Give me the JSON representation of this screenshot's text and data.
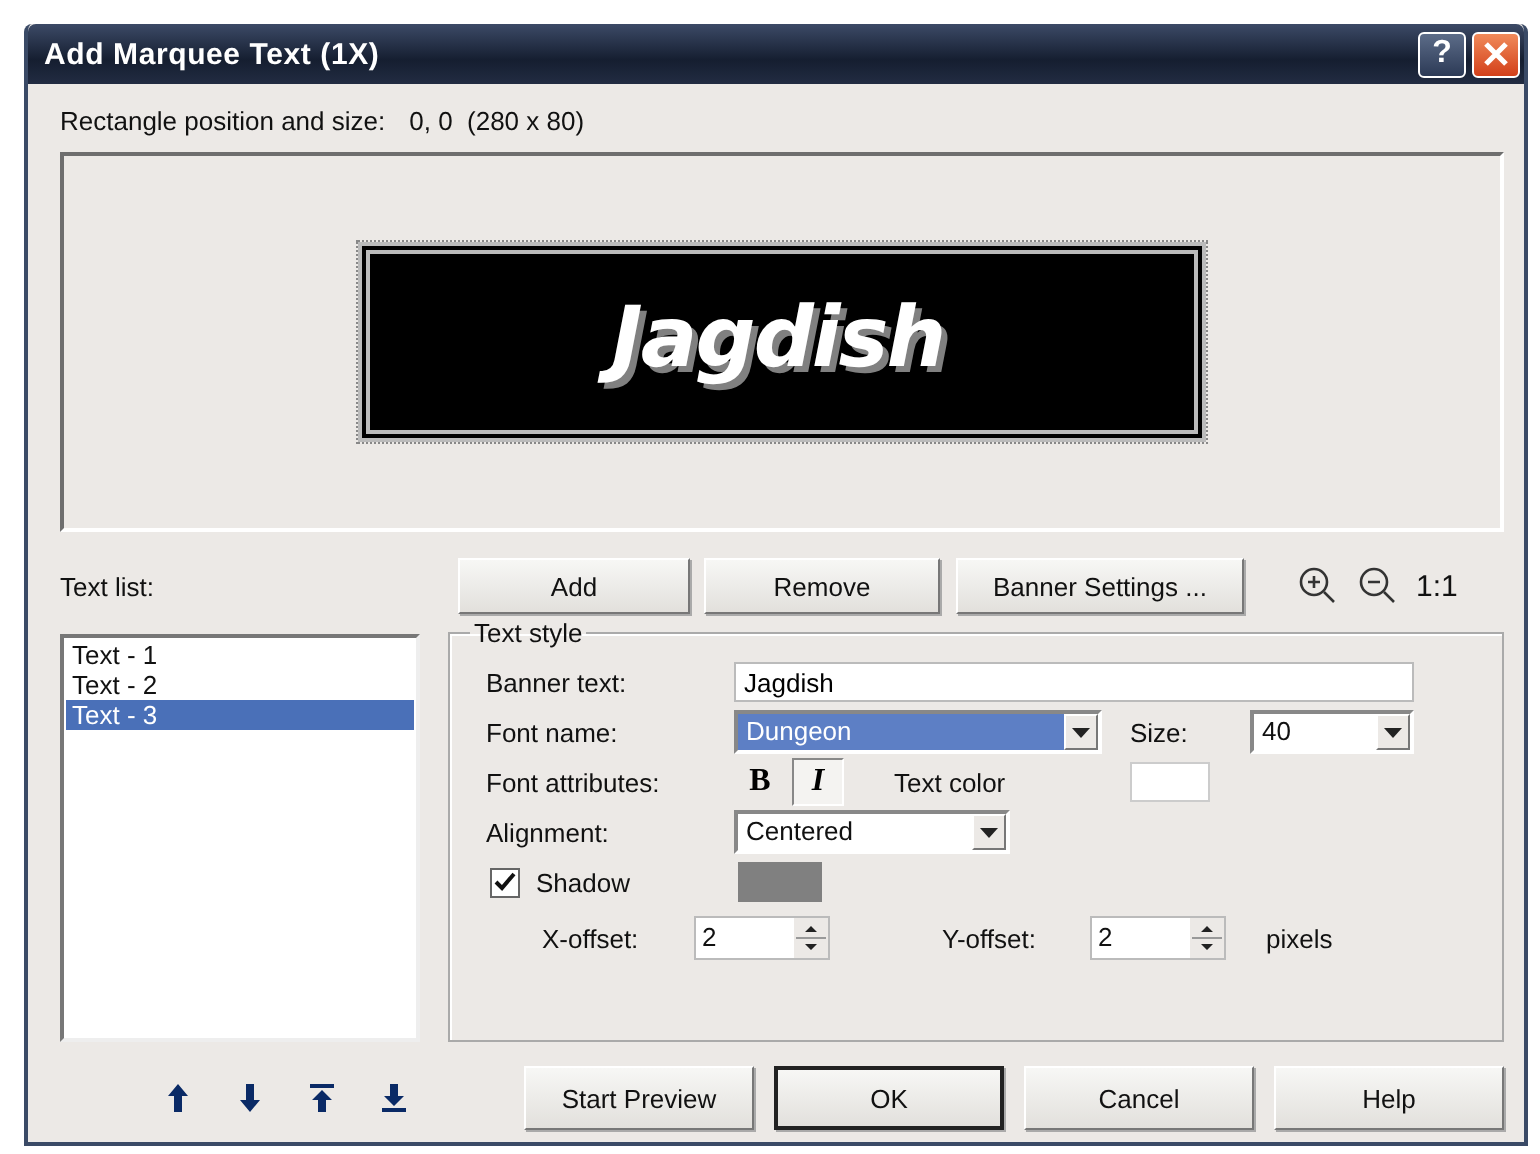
{
  "window": {
    "title": "Add Marquee Text (1X)",
    "help_glyph": "?"
  },
  "position": {
    "label": "Rectangle position and size:",
    "value": "0, 0  (280 x 80)"
  },
  "preview": {
    "text": "Jagdish"
  },
  "text_list": {
    "label": "Text list:",
    "items": [
      {
        "label": "Text - 1",
        "selected": false
      },
      {
        "label": "Text - 2",
        "selected": false
      },
      {
        "label": "Text - 3",
        "selected": true
      }
    ]
  },
  "toolbar": {
    "buttons": [
      "Add",
      "Remove",
      "Banner Settings ..."
    ],
    "zoom_label": "1:1"
  },
  "text_style": {
    "title": "Text style",
    "banner_text": {
      "label": "Banner text:",
      "value": "Jagdish"
    },
    "font_name": {
      "label": "Font name:",
      "value": "Dungeon",
      "highlighted": true
    },
    "size": {
      "label": "Size:",
      "value": "40"
    },
    "font_attributes": {
      "label": "Font attributes:",
      "bold": {
        "glyph": "B",
        "pressed": false
      },
      "italic": {
        "glyph": "I",
        "pressed": true
      }
    },
    "text_color": {
      "label": "Text color",
      "color": "#ffffff"
    },
    "alignment": {
      "label": "Alignment:",
      "value": "Centered"
    },
    "shadow": {
      "label": "Shadow",
      "checked": true,
      "color": "#808080"
    },
    "x_offset": {
      "label": "X-offset:",
      "value": "2"
    },
    "y_offset": {
      "label": "Y-offset:",
      "value": "2"
    },
    "units": "pixels"
  },
  "buttons": [
    {
      "label": "Start Preview",
      "default": false
    },
    {
      "label": "OK",
      "default": true
    },
    {
      "label": "Cancel",
      "default": false
    },
    {
      "label": "Help",
      "default": false
    }
  ]
}
